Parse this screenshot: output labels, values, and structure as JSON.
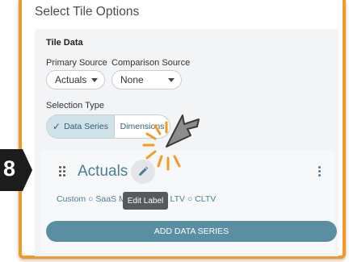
{
  "dialog": {
    "title": "Select Tile Options"
  },
  "tile_data": {
    "section_title": "Tile Data",
    "primary_source": {
      "label": "Primary Source",
      "value": "Actuals"
    },
    "comparison_source": {
      "label": "Comparison Source",
      "value": "None"
    },
    "selection_type": {
      "label": "Selection Type",
      "options": [
        "Data Series",
        "Dimensions"
      ],
      "selected": "Data Series"
    }
  },
  "series_card": {
    "name": "Actuals",
    "components_before_tooltip": "Custom ○ SaaS Me",
    "components_after_tooltip": "LTV ○ CLTV",
    "tooltip": "Edit Label"
  },
  "add_series_button": "ADD DATA SERIES",
  "tutorial": {
    "step_number": "8",
    "accent_color": "#f39a22"
  }
}
